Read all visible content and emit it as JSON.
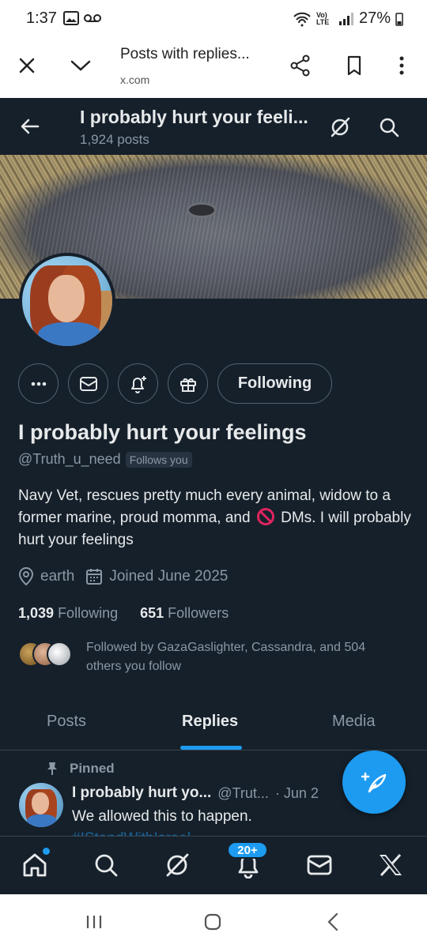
{
  "status_bar": {
    "time": "1:37",
    "battery": "27%",
    "net_label": "Vo) LTE"
  },
  "browser": {
    "title": "Posts with replies...",
    "url": "x.com"
  },
  "header": {
    "name": "I probably hurt your feeli...",
    "posts_count": "1,924 posts"
  },
  "profile": {
    "name": "I probably hurt your feelings",
    "handle": "@Truth_u_need",
    "follows_you": "Follows you",
    "following_button": "Following",
    "bio_part1": "Navy Vet, rescues pretty much every animal, widow to a former marine, proud momma,  and ",
    "bio_part2": " DMs.  I will probably hurt your feelings",
    "location": "earth",
    "joined": "Joined June 2025",
    "following_count": "1,039",
    "following_label": "Following",
    "followers_count": "651",
    "followers_label": "Followers",
    "followed_by": "Followed by GazaGaslighter, Cassandra, and 504 others you follow"
  },
  "tabs": [
    {
      "label": "Posts"
    },
    {
      "label": "Replies"
    },
    {
      "label": "Media"
    }
  ],
  "post": {
    "pinned_label": "Pinned",
    "author": "I probably hurt yo...",
    "handle": "@Trut...",
    "date": "· Jun 2",
    "text": "We allowed this to happen.",
    "tag": "#IStandWithIsrael"
  },
  "bottom_nav": {
    "notifications_badge": "20+"
  },
  "colors": {
    "background": "#15202b",
    "accent": "#1d9bf0",
    "text_primary": "#e7e9ea",
    "text_secondary": "#8b98a5"
  }
}
